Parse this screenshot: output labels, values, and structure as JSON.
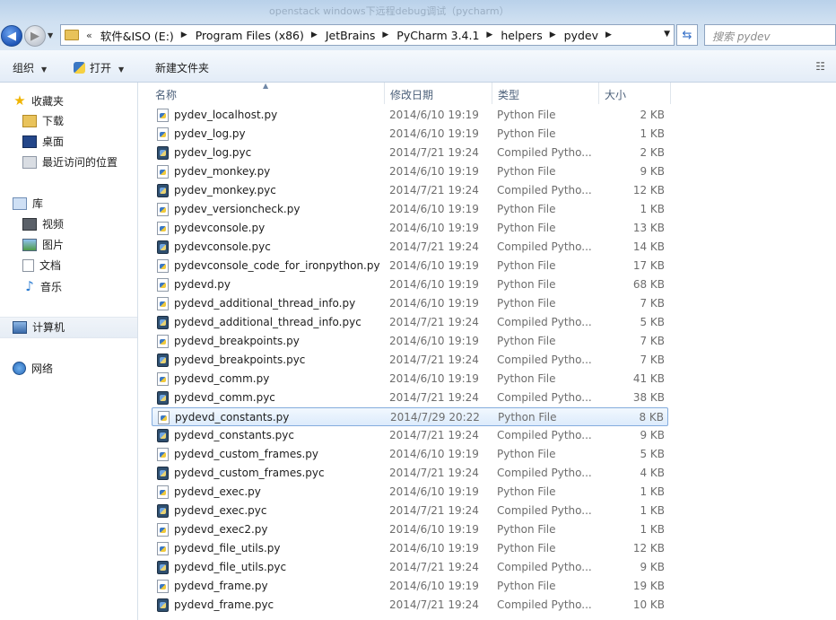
{
  "window": {
    "title": "openstack windows下远程debug调试（pycharm）"
  },
  "navigation": {
    "back_label": "◀",
    "forward_label": "▶",
    "address": {
      "overflow": "«",
      "breadcrumbs": [
        "软件&ISO (E:)",
        "Program Files (x86)",
        "JetBrains",
        "PyCharm 3.4.1",
        "helpers",
        "pydev"
      ]
    },
    "search_placeholder": "搜索 pydev"
  },
  "toolbar": {
    "organize_label": "组织",
    "open_label": "打开",
    "new_folder_label": "新建文件夹",
    "view_label": "☷"
  },
  "sidebar": {
    "favorites": {
      "label": "收藏夹",
      "items": [
        "下载",
        "桌面",
        "最近访问的位置"
      ]
    },
    "libraries": {
      "label": "库",
      "items": [
        "视频",
        "图片",
        "文档",
        "音乐"
      ]
    },
    "computer": {
      "label": "计算机"
    },
    "network": {
      "label": "网络"
    }
  },
  "columns": {
    "name": "名称",
    "date": "修改日期",
    "type": "类型",
    "size": "大小"
  },
  "files": [
    {
      "name": "pydev_localhost.py",
      "date": "2014/6/10 19:19",
      "type": "Python File",
      "size": "2 KB",
      "kind": "py"
    },
    {
      "name": "pydev_log.py",
      "date": "2014/6/10 19:19",
      "type": "Python File",
      "size": "1 KB",
      "kind": "py"
    },
    {
      "name": "pydev_log.pyc",
      "date": "2014/7/21 19:24",
      "type": "Compiled Pytho...",
      "size": "2 KB",
      "kind": "pyc"
    },
    {
      "name": "pydev_monkey.py",
      "date": "2014/6/10 19:19",
      "type": "Python File",
      "size": "9 KB",
      "kind": "py"
    },
    {
      "name": "pydev_monkey.pyc",
      "date": "2014/7/21 19:24",
      "type": "Compiled Pytho...",
      "size": "12 KB",
      "kind": "pyc"
    },
    {
      "name": "pydev_versioncheck.py",
      "date": "2014/6/10 19:19",
      "type": "Python File",
      "size": "1 KB",
      "kind": "py"
    },
    {
      "name": "pydevconsole.py",
      "date": "2014/6/10 19:19",
      "type": "Python File",
      "size": "13 KB",
      "kind": "py"
    },
    {
      "name": "pydevconsole.pyc",
      "date": "2014/7/21 19:24",
      "type": "Compiled Pytho...",
      "size": "14 KB",
      "kind": "pyc"
    },
    {
      "name": "pydevconsole_code_for_ironpython.py",
      "date": "2014/6/10 19:19",
      "type": "Python File",
      "size": "17 KB",
      "kind": "py"
    },
    {
      "name": "pydevd.py",
      "date": "2014/6/10 19:19",
      "type": "Python File",
      "size": "68 KB",
      "kind": "py"
    },
    {
      "name": "pydevd_additional_thread_info.py",
      "date": "2014/6/10 19:19",
      "type": "Python File",
      "size": "7 KB",
      "kind": "py"
    },
    {
      "name": "pydevd_additional_thread_info.pyc",
      "date": "2014/7/21 19:24",
      "type": "Compiled Pytho...",
      "size": "5 KB",
      "kind": "pyc"
    },
    {
      "name": "pydevd_breakpoints.py",
      "date": "2014/6/10 19:19",
      "type": "Python File",
      "size": "7 KB",
      "kind": "py"
    },
    {
      "name": "pydevd_breakpoints.pyc",
      "date": "2014/7/21 19:24",
      "type": "Compiled Pytho...",
      "size": "7 KB",
      "kind": "pyc"
    },
    {
      "name": "pydevd_comm.py",
      "date": "2014/6/10 19:19",
      "type": "Python File",
      "size": "41 KB",
      "kind": "py"
    },
    {
      "name": "pydevd_comm.pyc",
      "date": "2014/7/21 19:24",
      "type": "Compiled Pytho...",
      "size": "38 KB",
      "kind": "pyc"
    },
    {
      "name": "pydevd_constants.py",
      "date": "2014/7/29 20:22",
      "type": "Python File",
      "size": "8 KB",
      "kind": "py",
      "selected": true
    },
    {
      "name": "pydevd_constants.pyc",
      "date": "2014/7/21 19:24",
      "type": "Compiled Pytho...",
      "size": "9 KB",
      "kind": "pyc"
    },
    {
      "name": "pydevd_custom_frames.py",
      "date": "2014/6/10 19:19",
      "type": "Python File",
      "size": "5 KB",
      "kind": "py"
    },
    {
      "name": "pydevd_custom_frames.pyc",
      "date": "2014/7/21 19:24",
      "type": "Compiled Pytho...",
      "size": "4 KB",
      "kind": "pyc"
    },
    {
      "name": "pydevd_exec.py",
      "date": "2014/6/10 19:19",
      "type": "Python File",
      "size": "1 KB",
      "kind": "py"
    },
    {
      "name": "pydevd_exec.pyc",
      "date": "2014/7/21 19:24",
      "type": "Compiled Pytho...",
      "size": "1 KB",
      "kind": "pyc"
    },
    {
      "name": "pydevd_exec2.py",
      "date": "2014/6/10 19:19",
      "type": "Python File",
      "size": "1 KB",
      "kind": "py"
    },
    {
      "name": "pydevd_file_utils.py",
      "date": "2014/6/10 19:19",
      "type": "Python File",
      "size": "12 KB",
      "kind": "py"
    },
    {
      "name": "pydevd_file_utils.pyc",
      "date": "2014/7/21 19:24",
      "type": "Compiled Pytho...",
      "size": "9 KB",
      "kind": "pyc"
    },
    {
      "name": "pydevd_frame.py",
      "date": "2014/6/10 19:19",
      "type": "Python File",
      "size": "19 KB",
      "kind": "py"
    },
    {
      "name": "pydevd_frame.pyc",
      "date": "2014/7/21 19:24",
      "type": "Compiled Pytho...",
      "size": "10 KB",
      "kind": "pyc"
    }
  ]
}
